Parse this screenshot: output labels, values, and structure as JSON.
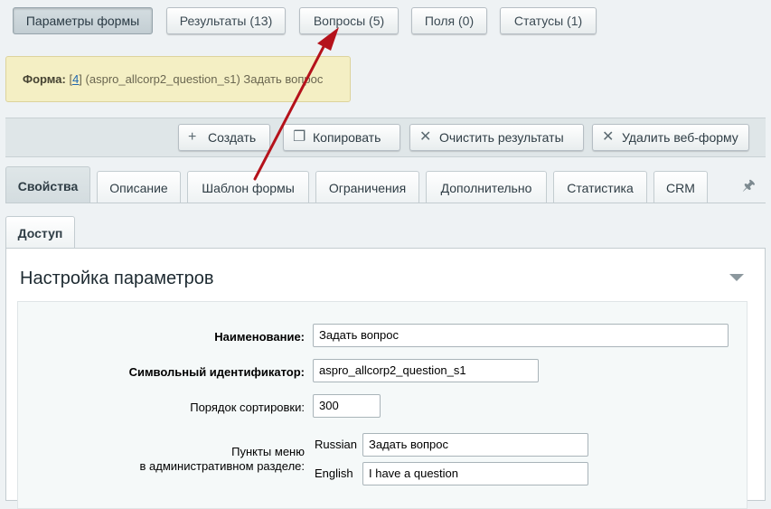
{
  "top_tabs": [
    {
      "label": "Параметры формы"
    },
    {
      "label": "Результаты (13)"
    },
    {
      "label": "Вопросы (5)"
    },
    {
      "label": "Поля (0)"
    },
    {
      "label": "Статусы (1)"
    }
  ],
  "info": {
    "prefix": "Форма:",
    "id_link": "4",
    "open_bracket": "[",
    "close_bracket": "]",
    "text": " (aspro_allcorp2_question_s1) Задать вопрос"
  },
  "toolbar": {
    "create": "Создать",
    "copy": "Копировать",
    "clear": "Очистить результаты",
    "delete": "Удалить веб-форму"
  },
  "prop_tabs": [
    {
      "label": "Свойства"
    },
    {
      "label": "Описание"
    },
    {
      "label": "Шаблон формы"
    },
    {
      "label": "Ограничения"
    },
    {
      "label": "Дополнительно"
    },
    {
      "label": "Статистика"
    },
    {
      "label": "CRM"
    }
  ],
  "sub_tab": "Доступ",
  "section_title": "Настройка параметров",
  "fields": {
    "name_label": "Наименование:",
    "name_value": "Задать вопрос",
    "code_label": "Символьный идентификатор:",
    "code_value": "aspro_allcorp2_question_s1",
    "sort_label": "Порядок сортировки:",
    "sort_value": "300",
    "menu_label_1": "Пункты меню",
    "menu_label_2": "в административном разделе:",
    "lang_ru": "Russian",
    "menu_ru": "Задать вопрос",
    "lang_en": "English",
    "menu_en": "I have a question"
  },
  "colors": {
    "arrow": "#b5121b",
    "info_bg": "#f4efc4"
  }
}
